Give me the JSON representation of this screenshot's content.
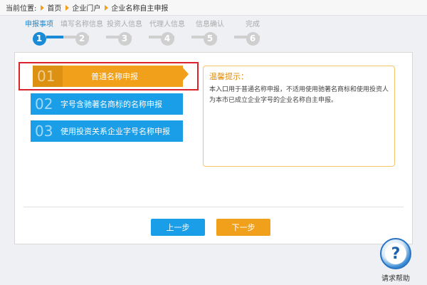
{
  "breadcrumb": {
    "prefix": "当前位置:",
    "items": [
      "首页",
      "企业门户",
      "企业名称自主申报"
    ]
  },
  "steps": [
    {
      "label": "申报事项",
      "number": "1",
      "active": true
    },
    {
      "label": "填写名称信息",
      "number": "2",
      "active": false
    },
    {
      "label": "投资人信息",
      "number": "3",
      "active": false
    },
    {
      "label": "代理人信息",
      "number": "4",
      "active": false
    },
    {
      "label": "信息确认",
      "number": "5",
      "active": false
    },
    {
      "label": "完成",
      "number": "6",
      "active": false
    }
  ],
  "options": [
    {
      "num": "01",
      "label": "普通名称申报",
      "selected": true
    },
    {
      "num": "02",
      "label": "字号含驰著名商标的名称申报",
      "selected": false
    },
    {
      "num": "03",
      "label": "使用投资关系企业字号名称申报",
      "selected": false
    }
  ],
  "tip": {
    "title": "温馨提示：",
    "text": "本入口用于普通名称申报，不适用使用驰著名商标和使用投资人为本市已成立企业字号的企业名称自主申报。"
  },
  "buttons": {
    "prev": "上一步",
    "next": "下一步"
  },
  "help": {
    "label": "请求帮助",
    "icon": "question-icon"
  },
  "colors": {
    "primary_blue": "#1a9ee8",
    "accent_orange": "#f0a01a",
    "highlight_red": "#d9232d"
  }
}
